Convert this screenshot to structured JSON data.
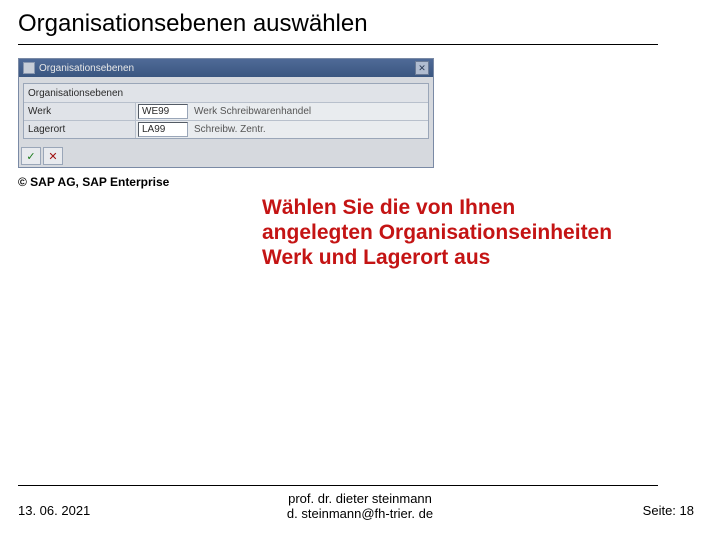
{
  "slide": {
    "title": "Organisationsebenen auswählen",
    "caption": "© SAP AG, SAP Enterprise",
    "instruction": "Wählen Sie die von Ihnen angelegten Organisationseinheiten Werk und Lagerort aus"
  },
  "dialog": {
    "title": "Organisationsebenen",
    "header_label": "Organisationsebenen",
    "rows": [
      {
        "label": "Werk",
        "code": "WE99",
        "desc": "Werk Schreibwarenhandel"
      },
      {
        "label": "Lagerort",
        "code": "LA99",
        "desc": "Schreibw. Zentr."
      }
    ],
    "btn_ok": "✓",
    "btn_cancel": "✕",
    "btn_close": "✕"
  },
  "footer": {
    "date": "13. 06. 2021",
    "author1": "prof. dr. dieter steinmann",
    "author2": "d. steinmann@fh-trier. de",
    "page": "Seite: 18"
  }
}
